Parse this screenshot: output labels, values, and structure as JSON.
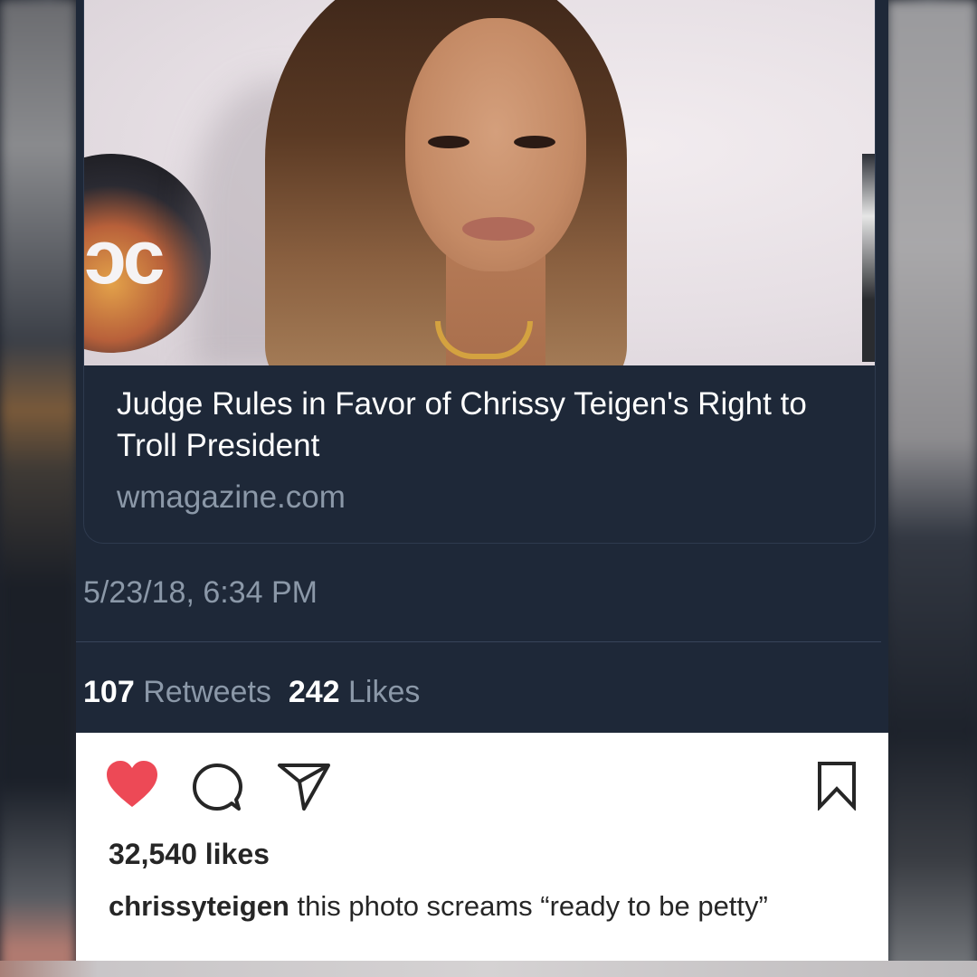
{
  "tweet": {
    "card": {
      "headline": "Judge Rules in Favor of Chrissy Teigen's Right to Troll President",
      "domain": "wmagazine.com",
      "photo_logo_text": "ɔc"
    },
    "timestamp": "5/23/18, 6:34 PM",
    "retweets_count": "107",
    "retweets_label": "Retweets",
    "likes_count": "242",
    "likes_label": "Likes"
  },
  "instagram": {
    "icons": [
      "heart-icon",
      "comment-icon",
      "share-icon",
      "bookmark-icon"
    ],
    "heart_color": "#ed4956",
    "likes_text": "32,540 likes",
    "username": "chrissyteigen",
    "caption": "this photo screams “ready to be petty”"
  },
  "colors": {
    "tweet_bg": "#1e2838",
    "secondary_text": "#8b98a8",
    "primary_text": "#ffffff",
    "ig_bg": "#ffffff"
  }
}
